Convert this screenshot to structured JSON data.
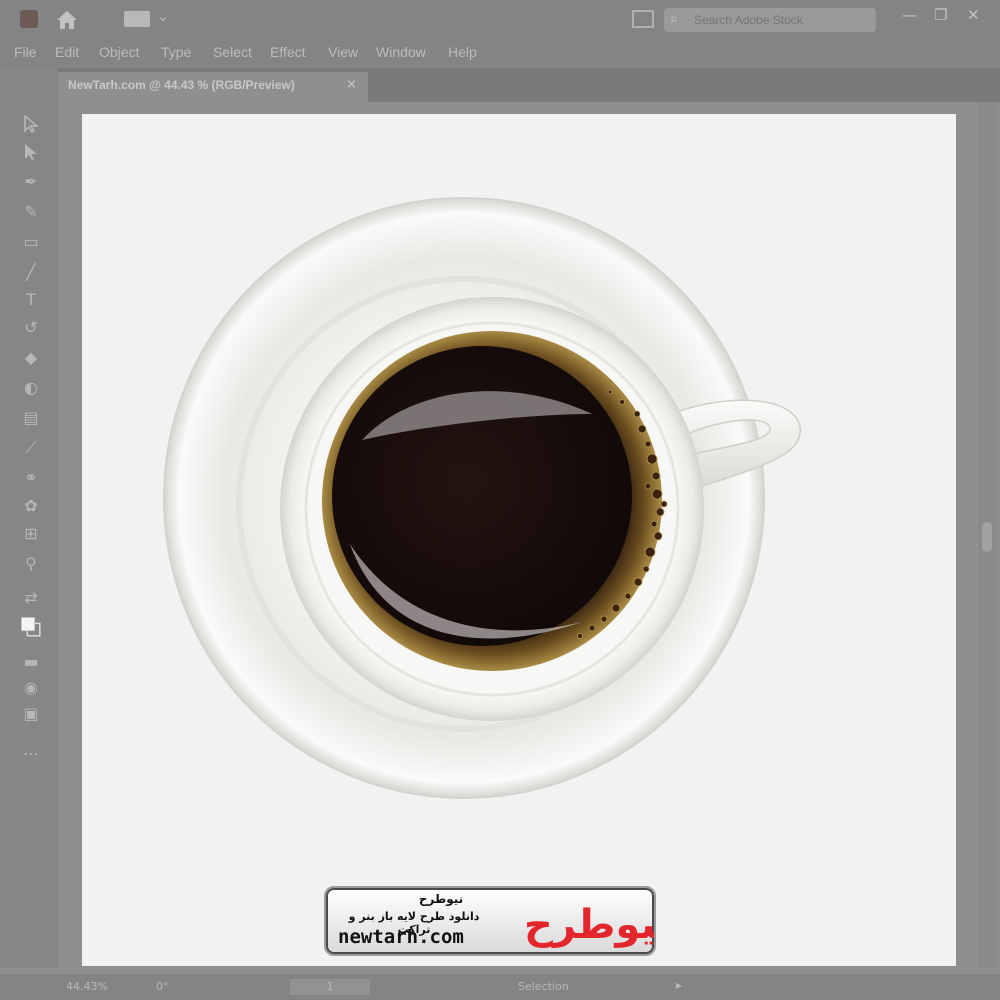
{
  "titlebar": {
    "search_placeholder": "Search Adobe Stock"
  },
  "menu": [
    "File",
    "Edit",
    "Object",
    "Type",
    "Select",
    "Effect",
    "View",
    "Window",
    "Help"
  ],
  "document_tab": {
    "title": "NewTarh.com @ 44.43 % (RGB/Preview)",
    "close": "×"
  },
  "tools": [
    "selection-tool-icon",
    "direct-selection-tool-icon",
    "pen-tool-icon",
    "curvature-tool-icon",
    "rectangle-tool-icon",
    "paintbrush-tool-icon",
    "type-tool-icon",
    "rotate-tool-icon",
    "eraser-tool-icon",
    "shape-builder-icon",
    "gradient-tool-icon",
    "eyedropper-tool-icon",
    "blend-tool-icon",
    "symbol-sprayer-icon",
    "artboard-tool-icon",
    "zoom-tool-icon"
  ],
  "status": {
    "zoom": "44.43%",
    "rotation": "0°",
    "page": "1",
    "mode": "Selection"
  },
  "watermark": {
    "brand_fa": "نیوطرح",
    "tagline_fa": "دانلود طرح لایه باز بنر و تراکت",
    "url": "newtarh.com",
    "logo_fa": "نیوطرح"
  },
  "colors": {
    "coffee": "#1a0e0c",
    "crema": "#8a6a2c",
    "logo_red": "#e3262b",
    "canvas": "#f2f2f2"
  }
}
